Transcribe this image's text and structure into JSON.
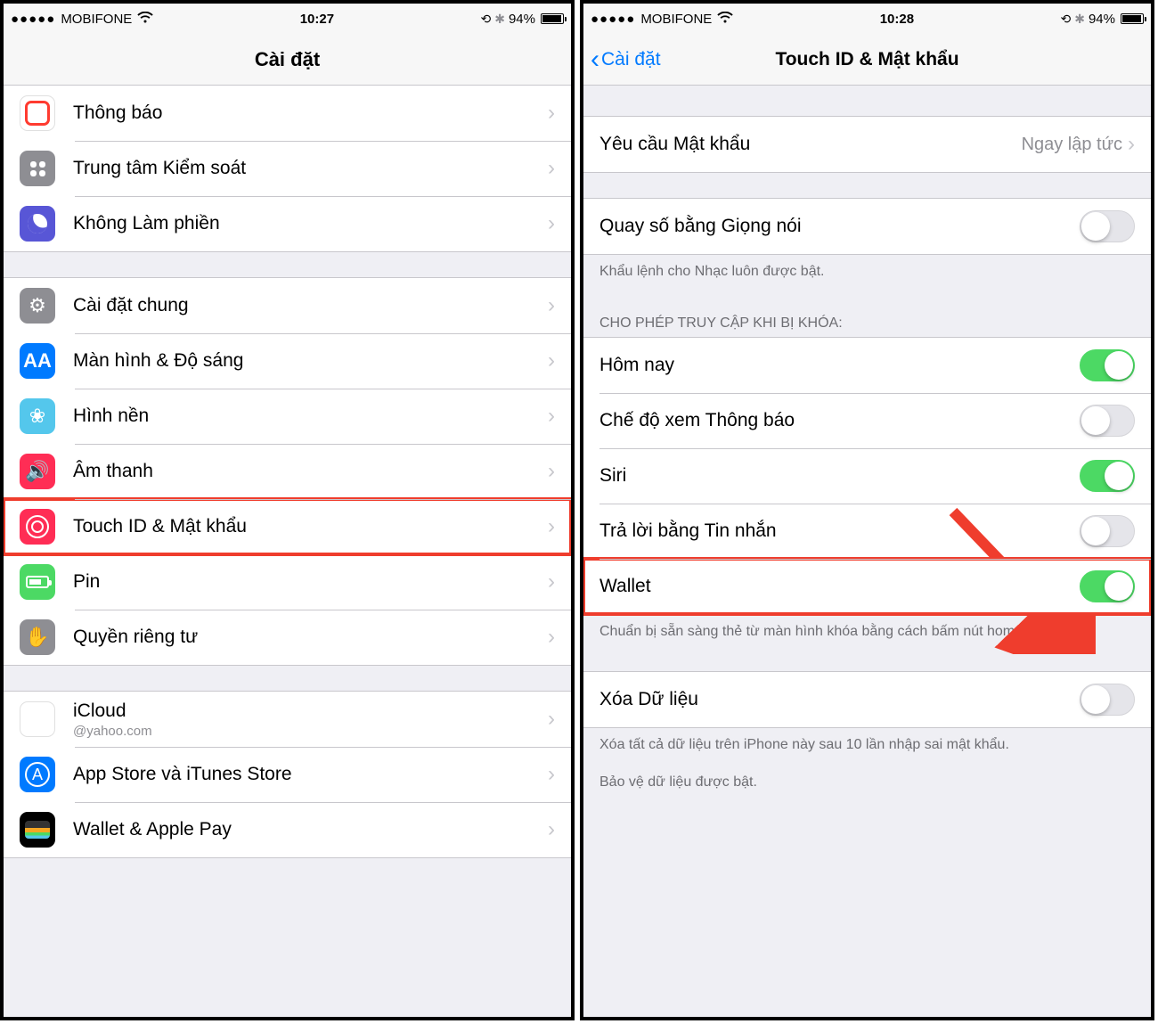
{
  "statusbar": {
    "carrier": "MOBIFONE",
    "time_left": "10:27",
    "time_right": "10:28",
    "battery_pct": "94%"
  },
  "left": {
    "nav_title": "Cài đặt",
    "groups": [
      {
        "rows": [
          {
            "id": "notifications",
            "label": "Thông báo"
          },
          {
            "id": "control-center",
            "label": "Trung tâm Kiểm soát"
          },
          {
            "id": "dnd",
            "label": "Không Làm phiền"
          }
        ]
      },
      {
        "rows": [
          {
            "id": "general",
            "label": "Cài đặt chung"
          },
          {
            "id": "display",
            "label": "Màn hình & Độ sáng"
          },
          {
            "id": "wallpaper",
            "label": "Hình nền"
          },
          {
            "id": "sound",
            "label": "Âm thanh"
          },
          {
            "id": "touchid",
            "label": "Touch ID & Mật khẩu",
            "highlight": true
          },
          {
            "id": "battery",
            "label": "Pin"
          },
          {
            "id": "privacy",
            "label": "Quyền riêng tư"
          }
        ]
      },
      {
        "rows": [
          {
            "id": "icloud",
            "label": "iCloud",
            "sub": "@yahoo.com"
          },
          {
            "id": "appstore",
            "label": "App Store và iTunes Store"
          },
          {
            "id": "walletpay",
            "label": "Wallet & Apple Pay"
          }
        ]
      }
    ]
  },
  "right": {
    "nav_back": "Cài đặt",
    "nav_title": "Touch ID & Mật khẩu",
    "require_passcode": {
      "label": "Yêu cầu Mật khẩu",
      "value": "Ngay lập tức"
    },
    "voice_dial": {
      "label": "Quay số bằng Giọng nói",
      "on": false,
      "footer": "Khẩu lệnh cho Nhạc luôn được bật."
    },
    "allow_header": "CHO PHÉP TRUY CẬP KHI BỊ KHÓA:",
    "allow_rows": [
      {
        "id": "today",
        "label": "Hôm nay",
        "on": true
      },
      {
        "id": "notif-view",
        "label": "Chế độ xem Thông báo",
        "on": false
      },
      {
        "id": "siri",
        "label": "Siri",
        "on": true
      },
      {
        "id": "reply-msg",
        "label": "Trả lời bằng Tin nhắn",
        "on": false
      },
      {
        "id": "wallet",
        "label": "Wallet",
        "on": true,
        "highlight": true
      }
    ],
    "allow_footer": "Chuẩn bị sẵn sàng thẻ từ màn hình khóa bằng cách bấm nút home hai lần.",
    "erase": {
      "label": "Xóa Dữ liệu",
      "on": false
    },
    "erase_footer1": "Xóa tất cả dữ liệu trên iPhone này sau 10 lần nhập sai mật khẩu.",
    "erase_footer2": "Bảo vệ dữ liệu được bật."
  }
}
